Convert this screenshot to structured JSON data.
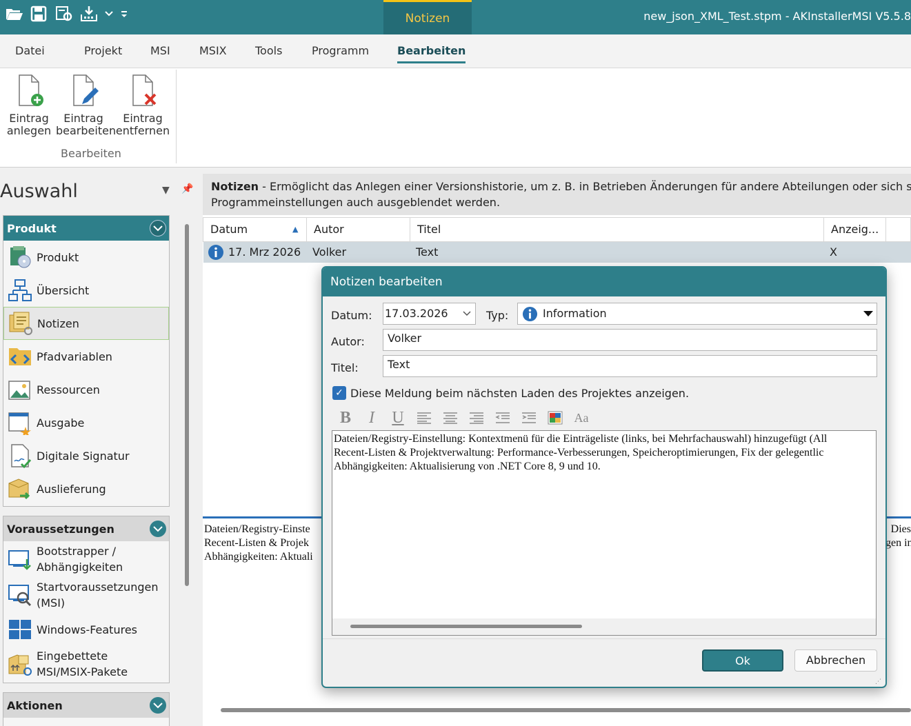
{
  "window": {
    "title": "new_json_XML_Test.stpm - AKInstallerMSI V5.5.8",
    "context_tab": "Notizen"
  },
  "quick_access": [
    {
      "icon": "open-folder-icon"
    },
    {
      "icon": "save-icon"
    },
    {
      "icon": "settings-save-icon"
    },
    {
      "icon": "build-icon"
    },
    {
      "icon": "chevron-down-icon"
    },
    {
      "icon": "customize-icon"
    }
  ],
  "menu": [
    {
      "label": "Datei",
      "active": false
    },
    {
      "label": "Projekt",
      "active": false
    },
    {
      "label": "MSI",
      "active": false
    },
    {
      "label": "MSIX",
      "active": false
    },
    {
      "label": "Tools",
      "active": false
    },
    {
      "label": "Programm",
      "active": false
    },
    {
      "label": "Bearbeiten",
      "active": true
    }
  ],
  "ribbon": {
    "buttons": [
      {
        "line1": "Eintrag",
        "line2": "anlegen",
        "icon": "document-add-icon"
      },
      {
        "line1": "Eintrag",
        "line2": "bearbeiten",
        "icon": "document-edit-icon"
      },
      {
        "line1": "Eintrag",
        "line2": "entfernen",
        "icon": "document-delete-icon"
      }
    ],
    "group_label": "Bearbeiten"
  },
  "sidebar": {
    "title": "Auswahl",
    "panels": [
      {
        "title": "Produkt",
        "items": [
          {
            "label": "Produkt",
            "icon": "product-icon"
          },
          {
            "label": "Übersicht",
            "icon": "overview-icon"
          },
          {
            "label": "Notizen",
            "icon": "notes-icon",
            "selected": true
          },
          {
            "label": "Pfadvariablen",
            "icon": "path-variables-icon"
          },
          {
            "label": "Ressourcen",
            "icon": "resources-icon"
          },
          {
            "label": "Ausgabe",
            "icon": "output-icon"
          },
          {
            "label": "Digitale Signatur",
            "icon": "signature-icon"
          },
          {
            "label": "Auslieferung",
            "icon": "delivery-icon"
          }
        ]
      },
      {
        "title": "Voraussetzungen",
        "items": [
          {
            "line1": "Bootstrapper /",
            "line2": "Abhängigkeiten",
            "icon": "bootstrapper-icon"
          },
          {
            "line1": "Startvoraussetzungen",
            "line2": "(MSI)",
            "icon": "launch-conditions-icon"
          },
          {
            "label": "Windows-Features",
            "icon": "windows-features-icon"
          },
          {
            "line1": "Eingebettete",
            "line2": "MSI/MSIX-Pakete",
            "icon": "embedded-packages-icon"
          }
        ]
      },
      {
        "title": "Aktionen",
        "items": []
      }
    ]
  },
  "description": {
    "title": "Notizen",
    "line1": " - Ermöglicht das Anlegen einer Versionshistorie, um z. B. in Betrieben Änderungen für andere Abteilungen oder sich selbst zu",
    "line2": "Programmeinstellungen auch ausgeblendet werden."
  },
  "grid": {
    "columns": [
      "Datum",
      "Autor",
      "Titel",
      "Anzeig..."
    ],
    "rows": [
      {
        "date": "17. Mrz 2026",
        "author": "Volker",
        "title": "Text",
        "show": "X",
        "type_icon": "info-icon"
      }
    ]
  },
  "preview": {
    "lines": [
      "Dateien/Registry-Einste",
      "Recent-Listen & Projek",
      "Abhängigkeiten: Aktuali"
    ],
    "right_lines": [
      "Dies",
      "gen in"
    ]
  },
  "dialog": {
    "title": "Notizen bearbeiten",
    "date_label": "Datum:",
    "date_value": "17.03.2026",
    "type_label": "Typ:",
    "type_value": "Information",
    "author_label": "Autor:",
    "author_value": "Volker",
    "title_label": "Titel:",
    "title_value": "Text",
    "show_checkbox_label": "Diese Meldung beim nächsten Laden des Projektes anzeigen.",
    "show_checked": true,
    "toolbar": {
      "bold": "B",
      "italic": "I",
      "underline": "U",
      "font": "Aa"
    },
    "editor_lines": [
      "Dateien/Registry-Einstellung: Kontextmenü für die Einträgeliste (links, bei Mehrfachauswahl) hinzugefügt (All",
      "Recent-Listen & Projektverwaltung: Performance-Verbesserungen, Speicheroptimierungen, Fix der gelegentlic",
      "Abhängigkeiten: Aktualisierung von .NET Core 8, 9 und 10."
    ],
    "ok_label": "Ok",
    "cancel_label": "Abbrechen"
  },
  "colors": {
    "accent": "#2e7f8a",
    "context_tab_text": "#f6c744",
    "selection_row": "#cfd9df",
    "delete_red": "#d9362b",
    "add_green": "#3aa14a"
  }
}
